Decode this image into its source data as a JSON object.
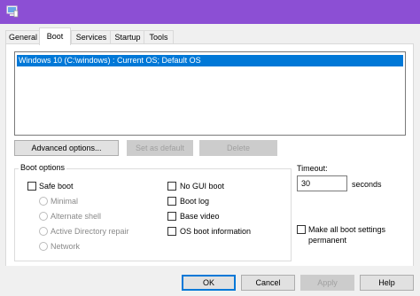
{
  "window": {
    "title": "",
    "titlebar_color": "#8c4fd4",
    "icon": "system-configuration-icon"
  },
  "tabs": [
    {
      "label": "General",
      "active": false
    },
    {
      "label": "Boot",
      "active": true
    },
    {
      "label": "Services",
      "active": false
    },
    {
      "label": "Startup",
      "active": false
    },
    {
      "label": "Tools",
      "active": false
    }
  ],
  "os_list": {
    "items": [
      "Windows 10 (C:\\windows) : Current OS; Default OS"
    ],
    "selected_color": "#0078d7"
  },
  "list_buttons": {
    "advanced": "Advanced options...",
    "set_default": "Set as default",
    "delete": "Delete"
  },
  "boot_options": {
    "legend": "Boot options",
    "safe_boot": {
      "label": "Safe boot",
      "checked": false
    },
    "safe_boot_modes": [
      "Minimal",
      "Alternate shell",
      "Active Directory repair",
      "Network"
    ],
    "no_gui_boot": {
      "label": "No GUI boot",
      "checked": false
    },
    "boot_log": {
      "label": "Boot log",
      "checked": false
    },
    "base_video": {
      "label": "Base video",
      "checked": false
    },
    "os_boot_info": {
      "label": "OS boot information",
      "checked": false
    }
  },
  "timeout": {
    "label": "Timeout:",
    "value": "30",
    "unit": "seconds"
  },
  "make_permanent": {
    "label_line1": "Make all boot settings",
    "label_line2": "permanent",
    "checked": false
  },
  "dialog_buttons": {
    "ok": "OK",
    "cancel": "Cancel",
    "apply": "Apply",
    "help": "Help"
  }
}
